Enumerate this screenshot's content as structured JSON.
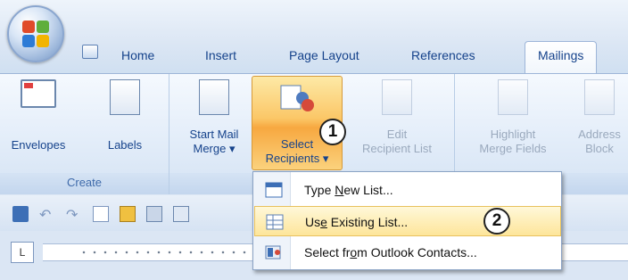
{
  "tabs": [
    "Home",
    "Insert",
    "Page Layout",
    "References",
    "Mailings"
  ],
  "active_tab": "Mailings",
  "groups": {
    "create": {
      "label": "Create",
      "envelopes": "Envelopes",
      "labels": "Labels"
    },
    "start": {
      "start_mail_merge_line1": "Start Mail",
      "start_mail_merge_line2": "Merge ▾",
      "select_recipients_line1": "Select",
      "select_recipients_line2": "Recipients ▾",
      "edit_list_line1": "Edit",
      "edit_list_line2": "Recipient List"
    },
    "write_insert": {
      "highlight_line1": "Highlight",
      "highlight_line2": "Merge Fields",
      "address_line1": "Address",
      "address_line2": "Block"
    }
  },
  "callouts": {
    "one": "1",
    "two": "2"
  },
  "menu": {
    "type_new_pre": "Type ",
    "type_new_u": "N",
    "type_new_post": "ew List...",
    "use_existing_pre": "Us",
    "use_existing_u": "e",
    "use_existing_post": " Existing List...",
    "outlook_pre": "Select fr",
    "outlook_u": "o",
    "outlook_post": "m Outlook Contacts..."
  },
  "ruler_box": "L",
  "colors": {
    "highlight": "#fbc767",
    "ribbon_text": "#15428b"
  }
}
